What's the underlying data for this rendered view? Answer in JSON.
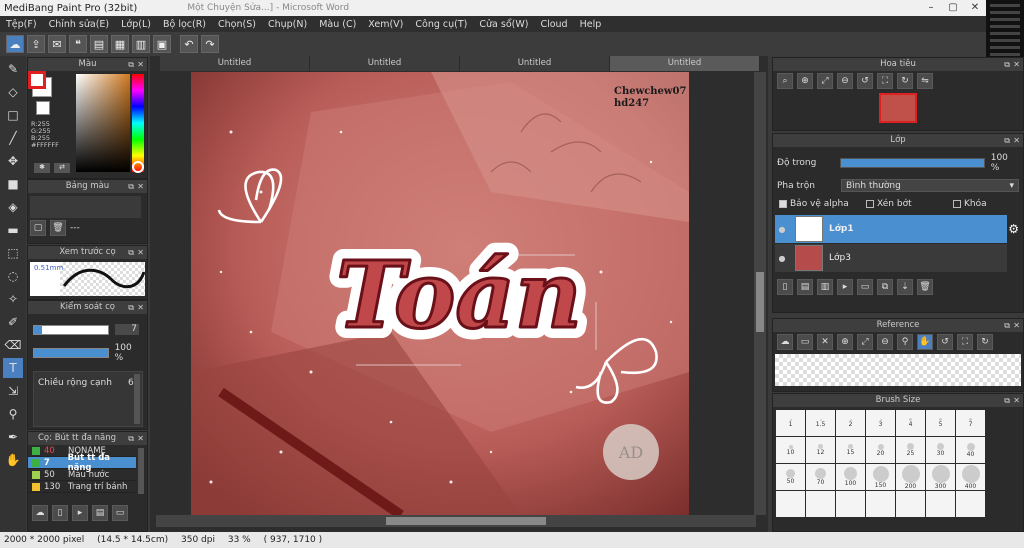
{
  "window": {
    "title": "MediBang Paint Pro (32bit)",
    "subtitle": "Một Chuyện Sửa...] - Microsoft Word"
  },
  "menu": [
    "Tệp(F)",
    "Chỉnh sửa(E)",
    "Lớp(L)",
    "Bộ lọc(R)",
    "Chọn(S)",
    "Chụp(N)",
    "Màu (C)",
    "Xem(V)",
    "Công cụ(T)",
    "Cửa sổ(W)",
    "Cloud",
    "Help"
  ],
  "tabs": [
    "Untitled",
    "Untitled",
    "Untitled",
    "Untitled"
  ],
  "color_panel": {
    "title": "Màu",
    "rgb_r": "R:255",
    "rgb_g": "G:255",
    "rgb_b": "B:255",
    "hex": "#FFFFFF",
    "primary": "#e02020",
    "secondary": "#ffffff"
  },
  "palette_panel": {
    "title": "Bảng màu",
    "field": "---"
  },
  "preview_panel": {
    "title": "Xem trước cọ",
    "size": "0.51mm"
  },
  "brushctrl_panel": {
    "title": "Kiểm soát cọ",
    "size_value": "7",
    "opacity_value": "100 %",
    "width_label": "Chiều rộng cạnh",
    "width_value": "6"
  },
  "brushlist_panel": {
    "title": "Cọ: Bút tt đa năng",
    "items": [
      {
        "num": "40",
        "name": "NONAME",
        "color": "#3cb043",
        "selected": false
      },
      {
        "num": "7",
        "name": "Bút tt đa năng",
        "color": "#3cb043",
        "selected": true
      },
      {
        "num": "50",
        "name": "Màu nước",
        "color": "#a0d050",
        "selected": false
      },
      {
        "num": "130",
        "name": "Trang trí bánh",
        "color": "#f0c030",
        "selected": false
      }
    ]
  },
  "navigator_panel": {
    "title": "Hoa tiêu"
  },
  "layer_panel": {
    "title": "Lớp",
    "opacity_label": "Độ trong",
    "opacity_value": "100 %",
    "opacity_fraction": 1.0,
    "blend_label": "Pha trộn",
    "blend_value": "Bình thường",
    "protect_alpha": "Bảo vệ alpha",
    "clip": "Xén bớt",
    "lock": "Khóa",
    "layers": [
      {
        "name": "Lớp1",
        "selected": true
      },
      {
        "name": "Lớp3",
        "selected": false
      }
    ]
  },
  "reference_panel": {
    "title": "Reference"
  },
  "brushsize_panel": {
    "title": "Brush Size",
    "sizes": [
      "1",
      "1.5",
      "2",
      "3",
      "4",
      "5",
      "7",
      "10",
      "12",
      "15",
      "20",
      "25",
      "30",
      "40",
      "50",
      "70",
      "100",
      "150",
      "200",
      "300",
      "400",
      "",
      "",
      "",
      "",
      "",
      "",
      ""
    ]
  },
  "artwork": {
    "main_text": "Toán",
    "credit_line1": "Chewchew07",
    "credit_line2": "hd247",
    "seal_text": "AD",
    "bg_color": "#c46a65"
  },
  "status": {
    "dims": "2000 * 2000 pixel",
    "cm": "(14.5 * 14.5cm)",
    "dpi": "350 dpi",
    "zoom": "33 %",
    "coords": "( 937, 1710 )"
  }
}
